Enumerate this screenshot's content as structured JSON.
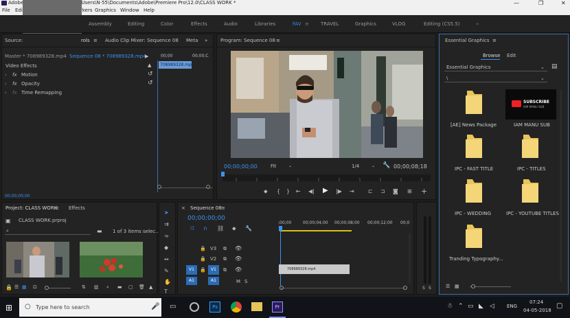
{
  "titlebar": {
    "text": "Adobe Premiere Pro 12.0 - C:\\Users\\N-55\\Documents\\Adobe\\Premiere Pro\\12.0\\CLASS WORK *",
    "app_short": "Adobe",
    "path_tail": "\\Users\\N-55\\Documents\\Adobe\\Premiere Pro\\12.0\\CLASS WORK *"
  },
  "menu": {
    "file": "File",
    "edit": "Edi",
    "markers": "rkers",
    "graphics": "Graphics",
    "window": "Window",
    "help": "Help"
  },
  "workspaces": [
    "Assembly",
    "Editing",
    "Color",
    "Effects",
    "Audio",
    "Libraries",
    "FAV",
    "TRAVEL",
    "Graphics",
    "VLOG",
    "Editing (CS5.5)"
  ],
  "workspace_active": "FAV",
  "effect_controls": {
    "tabs": {
      "source": "Source:",
      "controls": "rols",
      "mixer": "Audio Clip Mixer: Sequence 08",
      "meta": "Meta"
    },
    "master": "Master * 708989328.mp4",
    "clip": "Sequence 08 * 708989328.mp4",
    "time_start": "00;00",
    "time_end": "00;00;C",
    "clip_label": "708989328.mp4",
    "section": "Video Effects",
    "effects": [
      "Motion",
      "Opacity",
      "Time Remapping"
    ],
    "timecode": "00;00;00;00"
  },
  "program": {
    "title": "Program: Sequence 08",
    "timecode": "00;00;00;00",
    "fit": "Fit",
    "ratio": "1/4",
    "duration": "00;00;08;18"
  },
  "essential": {
    "title": "Essential Graphics",
    "tabs": [
      "Browse",
      "Edit"
    ],
    "dropdown": "Essential Graphics",
    "path": "\\",
    "items": [
      {
        "label": "[AE] News Package",
        "type": "folder"
      },
      {
        "label": "IAM MANU SUB",
        "type": "thumb",
        "thumb_text": "SUBSCRIBE",
        "thumb_sub": "IAM MANU SUB"
      },
      {
        "label": "IPC - FAST TITLE",
        "type": "folder"
      },
      {
        "label": "IPC - TITLES",
        "type": "folder"
      },
      {
        "label": "IPC - WEDDING",
        "type": "folder"
      },
      {
        "label": "IPC - YOUTUBE TITLES",
        "type": "folder"
      },
      {
        "label": "Tranding Typography...",
        "type": "folder"
      }
    ]
  },
  "project": {
    "title": "Project: CLASS WORK",
    "effects_tab": "Effects",
    "file": "CLASS WORK.prproj",
    "count": "1 of 3 items selec..."
  },
  "timeline": {
    "title": "Sequence 08",
    "timecode": "00;00;00;00",
    "ruler": [
      ";00;00",
      "00;00;04;00",
      "00;00;08;00",
      "00;00;12;00",
      "00;0"
    ],
    "tracks": {
      "v3": "V3",
      "v2": "V2",
      "v1": "V1",
      "a1": "A1"
    },
    "clip": "708989328.mp4"
  },
  "taskbar": {
    "search_placeholder": "Type here to search",
    "lang": "ENG",
    "time": "07:24",
    "date": "04-05-2018"
  },
  "colors": {
    "accent": "#2d8ceb",
    "panel": "#232323",
    "bg": "#1d1d1d",
    "taskbar": "#101318"
  }
}
